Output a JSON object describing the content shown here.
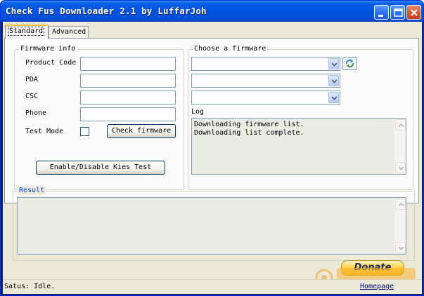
{
  "window": {
    "title": "Check Fus Downloader 2.1 by LuffarJoh"
  },
  "tabs": [
    {
      "label": "Standard",
      "active": true
    },
    {
      "label": "Advanced",
      "active": false
    }
  ],
  "firmware_info": {
    "group_label": "Firmware info",
    "product_code_label": "Product Code",
    "product_code_value": "",
    "pda_label": "PDA",
    "pda_value": "",
    "csc_label": "CSC",
    "csc_value": "",
    "phone_label": "Phone",
    "phone_value": "",
    "test_mode_label": "Test Mode",
    "test_mode_checked": false,
    "check_firmware_label": "Check firmware",
    "kies_test_label": "Enable/Disable Kies Test"
  },
  "choose_firmware": {
    "group_label": "Choose a firmware",
    "combo1_value": "",
    "combo2_value": "",
    "combo3_value": "",
    "log_label": "Log",
    "log_lines": [
      "Downloading firmware list.",
      "Downloading list complete."
    ]
  },
  "result": {
    "group_label": "Result",
    "text": ""
  },
  "donate_label": "Donate",
  "statusbar": {
    "status": "Satus: Idle.",
    "homepage_label": "Homepage"
  },
  "watermark": {
    "brand": "BBS",
    "site": "COM"
  },
  "colors": {
    "titlebar": "#0054e3",
    "accent": "#ffc83c",
    "link": "#000080"
  },
  "icons": [
    "minimize-icon",
    "maximize-icon",
    "close-icon",
    "refresh-icon",
    "chevron-down-icon",
    "scroll-up-icon",
    "scroll-down-icon"
  ]
}
